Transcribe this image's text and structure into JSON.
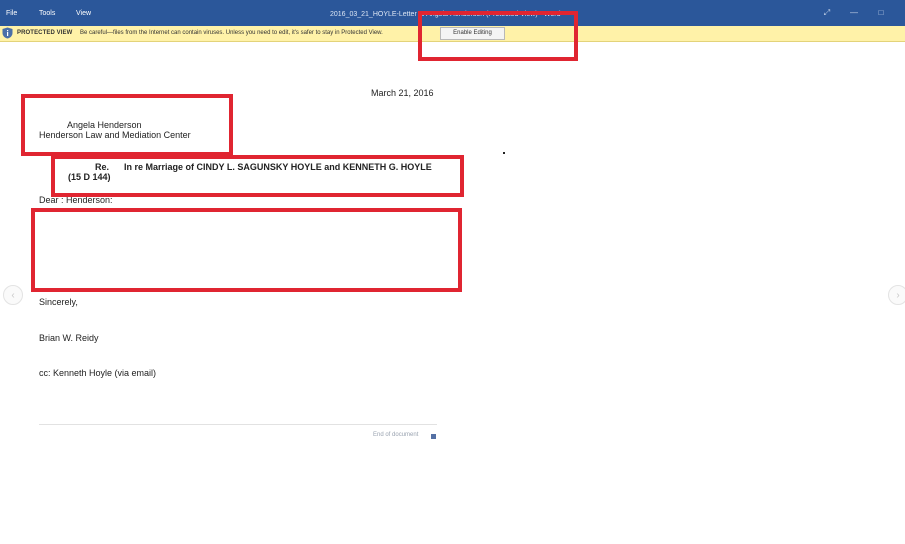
{
  "titlebar": {
    "menu": [
      "File",
      "Tools",
      "View"
    ],
    "document_title": "2016_03_21_HOYLE-Letter to Angela Henderson (Protected View) - Word",
    "restore_glyph": "⤢",
    "minimize_glyph": "—",
    "maximize_glyph": "□",
    "color": "#2b579a"
  },
  "protected_view": {
    "title": "PROTECTED VIEW",
    "message": "Be careful—files from the Internet can contain viruses. Unless you need to edit, it's safer to stay in Protected View.",
    "button_label": "Enable Editing",
    "bar_color": "#fff2a8"
  },
  "document": {
    "date": "March 21, 2016",
    "recipient_name": "Angela Henderson",
    "recipient_org": "Henderson Law and Mediation Center",
    "re_label": "Re.",
    "re_subject": "In re Marriage of CINDY L. SAGUNSKY HOYLE and KENNETH G. HOYLE",
    "case_number": "(15 D 144)",
    "salutation": "Dear : Henderson:",
    "closing": "Sincerely,",
    "signature": "Brian W. Reidy",
    "cc": "cc: Kenneth Hoyle (via email)",
    "end_marker": "End of document"
  },
  "navigation": {
    "prev_glyph": "‹",
    "next_glyph": "›"
  },
  "annotation_color": "#e02531"
}
